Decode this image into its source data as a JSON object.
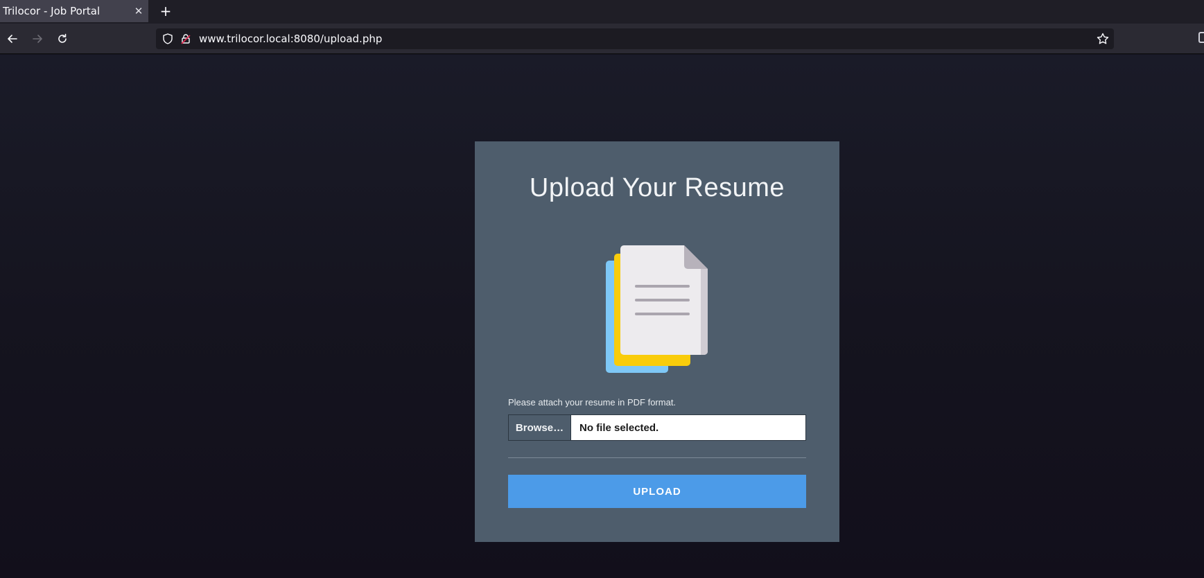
{
  "browser": {
    "tab_title": "Trilocor - Job Portal",
    "tab_close_icon": "close-icon",
    "new_tab_icon": "plus-icon",
    "url": "www.trilocor.local:8080/upload.php",
    "icons": [
      "back-arrow-icon",
      "forward-arrow-icon",
      "reload-icon",
      "shield-icon",
      "lock-icon",
      "star-icon"
    ]
  },
  "card": {
    "title": "Upload Your Resume",
    "illustration_icon": "documents-icon",
    "field_label": "Please attach your resume in PDF format.",
    "browse_label": "Browse…",
    "file_status": "No file selected.",
    "upload_label": "UPLOAD"
  },
  "colors": {
    "page_background": "#15141f",
    "card_background": "#4e5d6c",
    "upload_button": "#4c9be8",
    "doc_blue": "#7ec8f7",
    "doc_yellow": "#f9cc0b",
    "doc_paper": "#edebee"
  }
}
